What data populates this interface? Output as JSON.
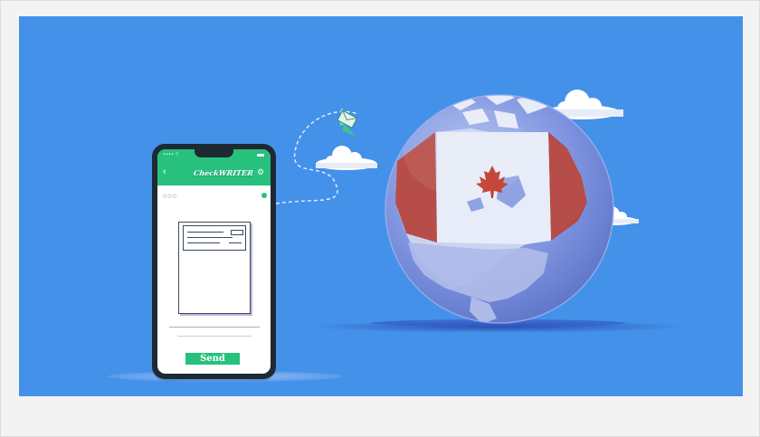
{
  "phone": {
    "status_text": "•••• ⌔",
    "back_icon": "‹",
    "logo": "CheckWRITER",
    "settings_icon": "⚙",
    "dots": "○○○",
    "send_label": "Send"
  },
  "colors": {
    "background": "#4491ea",
    "brand_green": "#27c07d",
    "phone_body": "#1d2a34",
    "flag_red": "#c0392b"
  },
  "icons": [
    "paper-plane-icon",
    "cloud-icon",
    "maple-leaf-icon",
    "globe-icon"
  ]
}
